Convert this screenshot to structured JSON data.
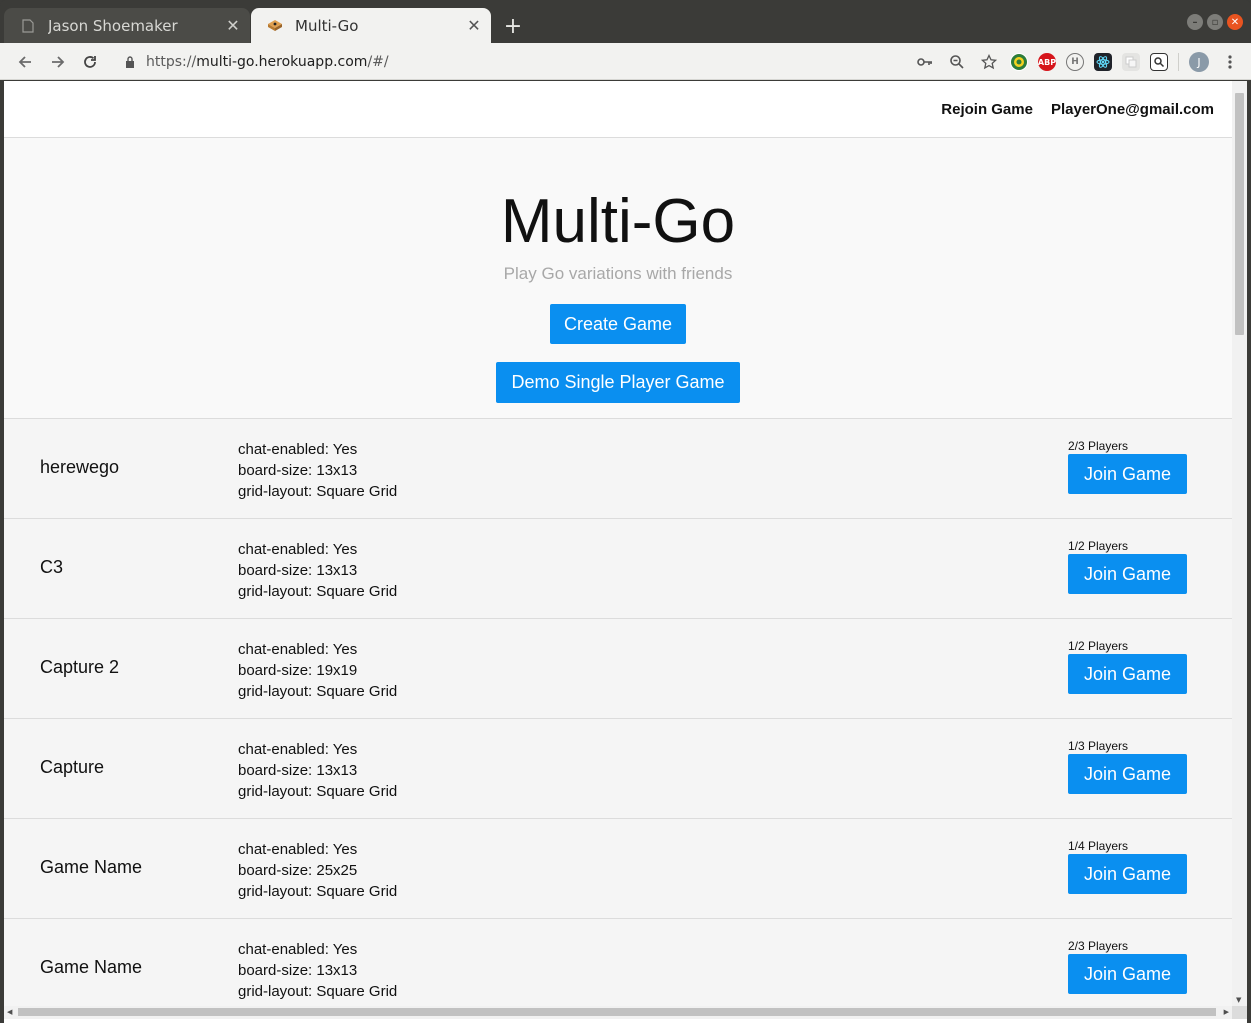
{
  "browser": {
    "tabs": [
      {
        "title": "Jason Shoemaker",
        "active": false,
        "favicon": "page-icon"
      },
      {
        "title": "Multi-Go",
        "active": true,
        "favicon": "multi-go-favicon"
      }
    ],
    "url_prefix": "https://",
    "url_host": "multi-go.herokuapp.com",
    "url_path": "/#/",
    "profile_initial": "J",
    "extensions": [
      "key-icon",
      "zoom-icon",
      "star-icon",
      "ext-globe-icon",
      "adblock-icon",
      "ext-h-icon",
      "react-devtools-icon",
      "ext-square-icon",
      "ext-search-icon"
    ],
    "adblock_label": "ABP",
    "ext_h_label": "H"
  },
  "nav": {
    "rejoin_label": "Rejoin Game",
    "user_email": "PlayerOne@gmail.com"
  },
  "hero": {
    "title": "Multi-Go",
    "subtitle": "Play Go variations with friends",
    "create_label": "Create Game",
    "demo_label": "Demo Single Player Game"
  },
  "games": [
    {
      "name": "herewego",
      "chat": "chat-enabled: Yes",
      "board": "board-size: 13x13",
      "grid": "grid-layout: Square Grid",
      "players": "2/3 Players",
      "join_label": "Join Game"
    },
    {
      "name": "C3",
      "chat": "chat-enabled: Yes",
      "board": "board-size: 13x13",
      "grid": "grid-layout: Square Grid",
      "players": "1/2 Players",
      "join_label": "Join Game"
    },
    {
      "name": "Capture 2",
      "chat": "chat-enabled: Yes",
      "board": "board-size: 19x19",
      "grid": "grid-layout: Square Grid",
      "players": "1/2 Players",
      "join_label": "Join Game"
    },
    {
      "name": "Capture",
      "chat": "chat-enabled: Yes",
      "board": "board-size: 13x13",
      "grid": "grid-layout: Square Grid",
      "players": "1/3 Players",
      "join_label": "Join Game"
    },
    {
      "name": "Game Name",
      "chat": "chat-enabled: Yes",
      "board": "board-size: 25x25",
      "grid": "grid-layout: Square Grid",
      "players": "1/4 Players",
      "join_label": "Join Game"
    },
    {
      "name": "Game Name",
      "chat": "chat-enabled: Yes",
      "board": "board-size: 13x13",
      "grid": "grid-layout: Square Grid",
      "players": "2/3 Players",
      "join_label": "Join Game"
    }
  ],
  "colors": {
    "accent": "#0a8ff0",
    "hero_bg": "#f9f9f9",
    "list_bg": "#f5f5f5"
  }
}
